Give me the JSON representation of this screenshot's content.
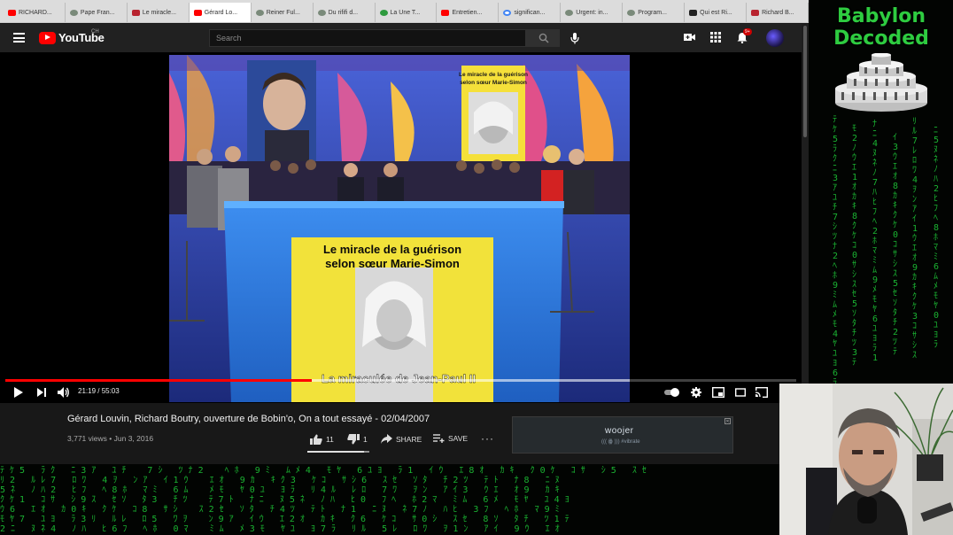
{
  "tabs": [
    {
      "label": "RICHARD...",
      "icon": "yt"
    },
    {
      "label": "Pape Fran...",
      "icon": "gray"
    },
    {
      "label": "Le miracle...",
      "icon": "red"
    },
    {
      "label": "Gérard Lo...",
      "icon": "yt",
      "active": true
    },
    {
      "label": "Reiner Ful...",
      "icon": "gray"
    },
    {
      "label": "Du rififi d...",
      "icon": "gray"
    },
    {
      "label": "La Une T...",
      "icon": "green"
    },
    {
      "label": "Entretien...",
      "icon": "yt"
    },
    {
      "label": "significan...",
      "icon": "goo"
    },
    {
      "label": "Urgent: in...",
      "icon": "gray"
    },
    {
      "label": "Program...",
      "icon": "gray"
    },
    {
      "label": "Qui est Ri...",
      "icon": "dark"
    },
    {
      "label": "Richard B...",
      "icon": "red"
    }
  ],
  "masthead": {
    "logo_text": "YouTube",
    "country_code": "CH",
    "search_placeholder": "Search",
    "notifications_badge": "9+"
  },
  "player": {
    "time": "21:19 / 55:03",
    "progress_fraction": 0.387,
    "video": {
      "poster_top_text": "Le miracle de la guérison selon sœur Marie-Simon",
      "poster_main_line1": "Le miracle de la guérison",
      "poster_main_line2": "selon sœur Marie-Simon",
      "caption": "La miraculée de Jean-Paul II"
    }
  },
  "video_info": {
    "title": "Gérard Louvin, Richard Boutry, ouverture de Bobin'o, On a tout essayé - 02/04/2007",
    "views": "3,771 views",
    "separator": "•",
    "date": "Jun 3, 2016",
    "likes": "11",
    "dislikes": "1",
    "share_label": "SHARE",
    "save_label": "SAVE",
    "like_ratio": 0.917
  },
  "ad": {
    "brand": "woojer",
    "tagline": "((( ꙮ ))) #vibrate"
  },
  "channel": {
    "name_line1": "Babylon",
    "name_line2": "Decoded"
  },
  "colors": {
    "accent": "#ff0000",
    "matrix_green": "#1fd13a",
    "background": "#181818"
  }
}
